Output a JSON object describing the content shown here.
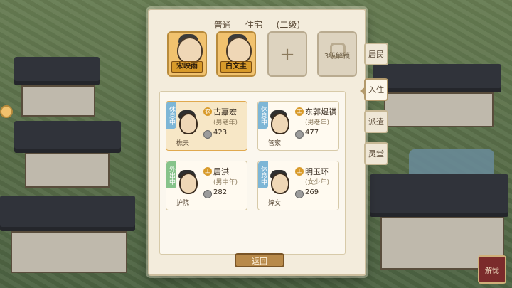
{
  "header": {
    "type": "普通",
    "category": "住宅",
    "level": "(二级)"
  },
  "slots": [
    {
      "name": "宋映雨"
    },
    {
      "name": "白文圭"
    },
    {
      "plus": "+"
    },
    {
      "lock_text": "3级解锁"
    }
  ],
  "side_tabs": [
    "居民",
    "入住",
    "派遣",
    "灵堂"
  ],
  "cards": [
    {
      "status": "休息中",
      "icon": "农",
      "name": "古嘉宏",
      "age": "(男老年)",
      "money": "423",
      "job": "樵夫"
    },
    {
      "status": "休息中",
      "icon": "工",
      "name": "东郭煜祺",
      "age": "(男老年)",
      "money": "477",
      "job": "管家"
    },
    {
      "status": "外出中",
      "icon": "工",
      "name": "居洪",
      "age": "(男中年)",
      "money": "282",
      "job": "护院"
    },
    {
      "status": "休息中",
      "icon": "工",
      "name": "明玉环",
      "age": "(女少年)",
      "money": "269",
      "job": "婢女"
    }
  ],
  "return_label": "返回",
  "corner_label": "解忧"
}
